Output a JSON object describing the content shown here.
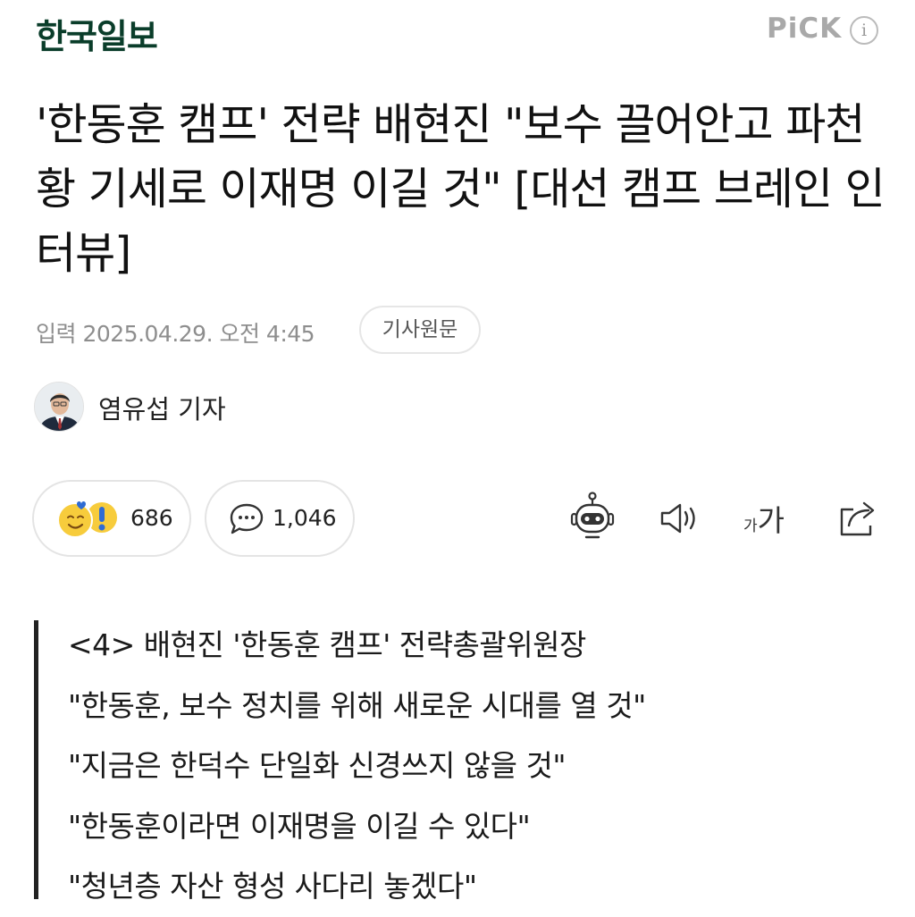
{
  "header": {
    "logo": "한국일보",
    "pick_label": "PiCK",
    "info_icon_glyph": "i"
  },
  "article": {
    "title": "'한동훈 캠프' 전략 배현진 \"보수 끌어안고 파천황 기세로 이재명 이길 것\" [대선 캠프 브레인 인터뷰]",
    "date_text": "입력 2025.04.29. 오전 4:45",
    "original_button": "기사원문",
    "reporter": "염유섭 기자"
  },
  "actions": {
    "reaction_count": "686",
    "comment_count": "1,046",
    "icons": [
      "emoji-reaction-icon",
      "comment-icon",
      "ai-summary-bot-icon",
      "speaker-icon",
      "font-size-icon",
      "share-icon"
    ],
    "font_size_small": "가",
    "font_size_big": "가"
  },
  "summary_lines": [
    "<4> 배현진 '한동훈 캠프' 전략총괄위원장",
    "\"한동훈, 보수 정치를 위해 새로운 시대를 열 것\"",
    "\"지금은 한덕수 단일화 신경쓰지 않을 것\"",
    "\"한동훈이라면 이재명을 이길 수 있다\"",
    "\"청년층 자산 형성 사다리 놓겠다\""
  ],
  "colors": {
    "logo": "#0a3d2a",
    "pick": "#a9a9a9",
    "meta_text": "#8e8e8e",
    "reaction_yellow": "#f7cc3c",
    "reaction_blue": "#2f6bd3"
  }
}
